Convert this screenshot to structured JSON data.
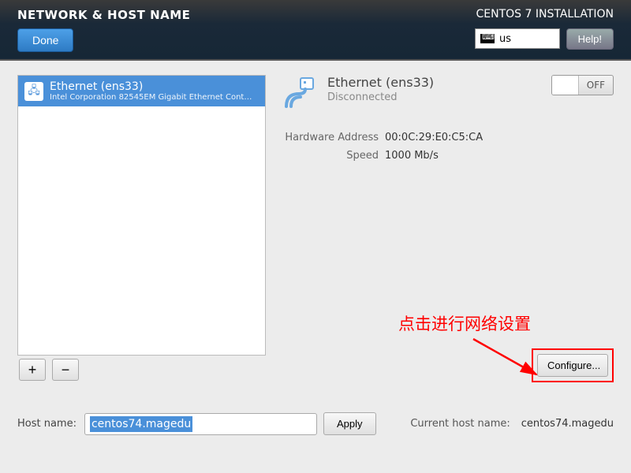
{
  "header": {
    "title": "NETWORK & HOST NAME",
    "installer": "CENTOS 7 INSTALLATION",
    "done": "Done",
    "help": "Help!",
    "keyboard": "us"
  },
  "devices": [
    {
      "name": "Ethernet (ens33)",
      "sub": "Intel Corporation 82545EM Gigabit Ethernet Controller ("
    }
  ],
  "buttons": {
    "add": "+",
    "remove": "−",
    "configure": "Configure...",
    "apply": "Apply"
  },
  "connection": {
    "name": "Ethernet (ens33)",
    "status": "Disconnected",
    "toggle": "OFF",
    "details": {
      "hwaddr_label": "Hardware Address",
      "hwaddr": "00:0C:29:E0:C5:CA",
      "speed_label": "Speed",
      "speed": "1000 Mb/s"
    }
  },
  "annotation": {
    "text": "点击进行网络设置"
  },
  "host": {
    "label": "Host name:",
    "value": "centos74.magedu",
    "current_label": "Current host name:",
    "current_value": "centos74.magedu"
  }
}
